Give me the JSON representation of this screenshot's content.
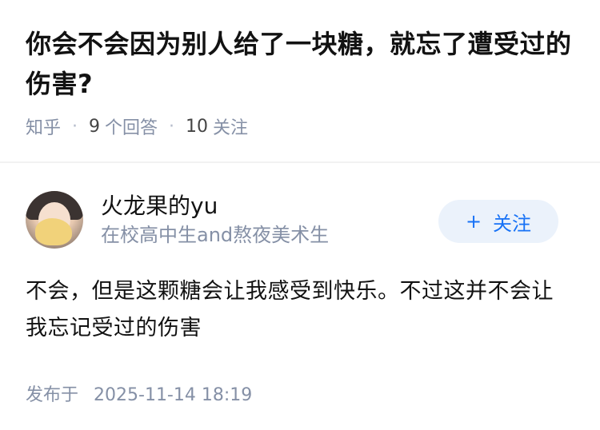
{
  "question": {
    "title": "你会不会因为别人给了一块糖，就忘了遭受过的伤害?",
    "source": "知乎",
    "answer_count": "9",
    "answer_label": "个回答",
    "follower_count": "10",
    "follower_label": "关注"
  },
  "answer": {
    "author": {
      "name": "火龙果的yu",
      "bio": "在校高中生and熬夜美术生"
    },
    "follow_button": {
      "icon": "+",
      "label": "关注"
    },
    "content": "不会，但是这颗糖会让我感受到快乐。不过这并不会让我忘记受过的伤害",
    "published_label": "发布于",
    "published_time": "2025-11-14 18:19"
  },
  "colors": {
    "primary_text": "#121212",
    "secondary_text": "#8590a6",
    "accent": "#1772f6",
    "button_bg": "#ebf2fb"
  }
}
